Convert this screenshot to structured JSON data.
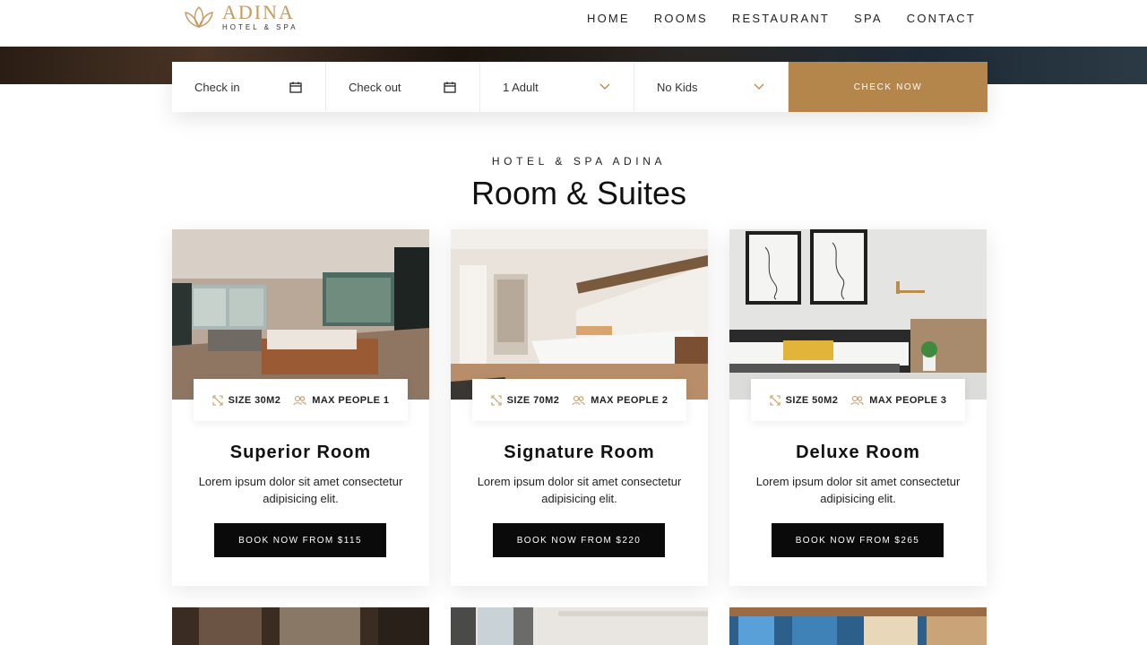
{
  "brand": {
    "name": "ADINA",
    "tagline": "HOTEL & SPA"
  },
  "nav": [
    "HOME",
    "ROOMS",
    "RESTAURANT",
    "SPA",
    "CONTACT"
  ],
  "booking": {
    "check_in": "Check in",
    "check_out": "Check out",
    "adults": "1 Adult",
    "kids": "No Kids",
    "submit": "CHECK NOW"
  },
  "section": {
    "overline": "HOTEL & SPA ADINA",
    "title": "Room & Suites"
  },
  "rooms": [
    {
      "size": "SIZE 30M2",
      "people": "MAX PEOPLE 1",
      "name": "Superior Room",
      "desc": "Lorem ipsum dolor sit amet consectetur adipisicing elit.",
      "cta": "BOOK NOW FROM $115"
    },
    {
      "size": "SIZE 70M2",
      "people": "MAX PEOPLE 2",
      "name": "Signature Room",
      "desc": "Lorem ipsum dolor sit amet consectetur adipisicing elit.",
      "cta": "BOOK NOW FROM $220"
    },
    {
      "size": "SIZE 50M2",
      "people": "MAX PEOPLE 3",
      "name": "Deluxe Room",
      "desc": "Lorem ipsum dolor sit amet consectetur adipisicing elit.",
      "cta": "BOOK NOW FROM $265"
    }
  ],
  "colors": {
    "accent": "#b5864c",
    "logo": "#c79a5f",
    "button": "#0a0a0a"
  }
}
